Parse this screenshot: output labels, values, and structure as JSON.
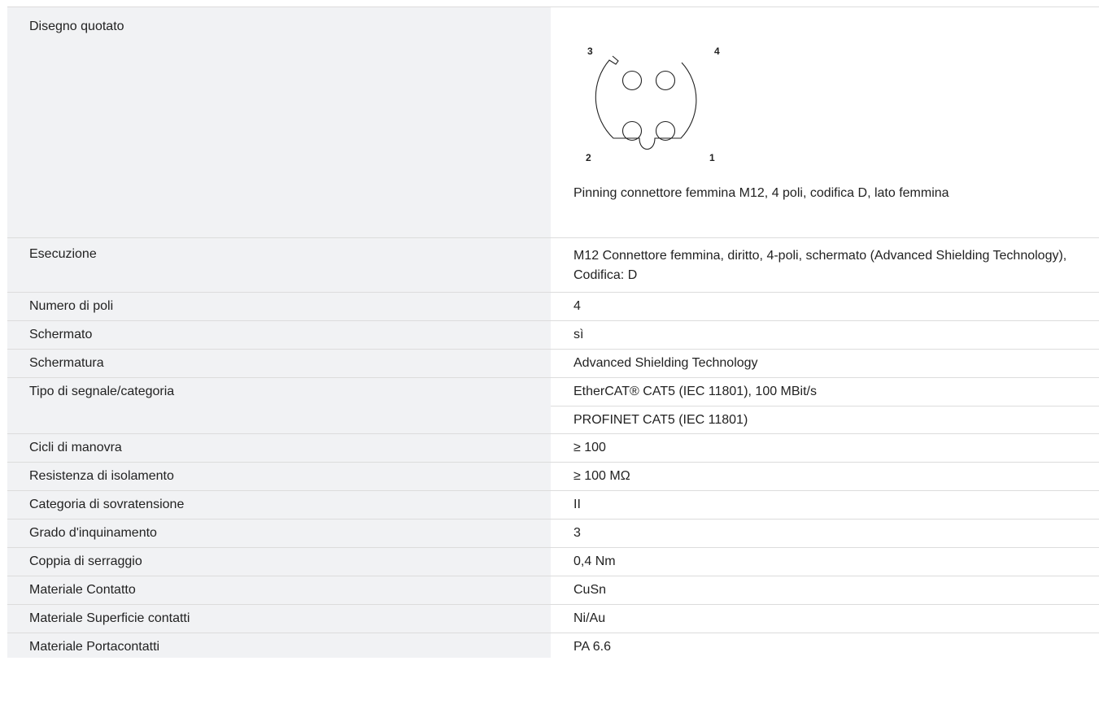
{
  "drawing": {
    "label": "Disegno quotato",
    "pins": [
      "3",
      "4",
      "2",
      "1"
    ],
    "caption": "Pinning connettore femmina M12, 4 poli, codifica D, lato femmina"
  },
  "rows": [
    {
      "label": "Esecuzione",
      "value": "M12 Connettore femmina, diritto, 4-poli, schermato (Advanced Shielding Technology), Codifica: D"
    },
    {
      "label": "Numero di poli",
      "value": "4"
    },
    {
      "label": "Schermato",
      "value": "sì"
    },
    {
      "label": "Schermatura",
      "value": "Advanced Shielding Technology"
    },
    {
      "label": "Tipo di segnale/categoria",
      "values": [
        "EtherCAT® CAT5 (IEC 11801), 100 MBit/s",
        "PROFINET CAT5 (IEC 11801)"
      ]
    },
    {
      "label": "Cicli di manovra",
      "value": "≥ 100"
    },
    {
      "label": "Resistenza di isolamento",
      "value": "≥ 100 MΩ"
    },
    {
      "label": "Categoria di sovratensione",
      "value": "II"
    },
    {
      "label": "Grado d'inquinamento",
      "value": "3"
    },
    {
      "label": "Coppia di serraggio",
      "value": "0,4 Nm"
    },
    {
      "label": "Materiale Contatto",
      "value": "CuSn"
    },
    {
      "label": "Materiale Superficie contatti",
      "value": "Ni/Au"
    },
    {
      "label": "Materiale Portacontatti",
      "value": "PA 6.6"
    }
  ]
}
